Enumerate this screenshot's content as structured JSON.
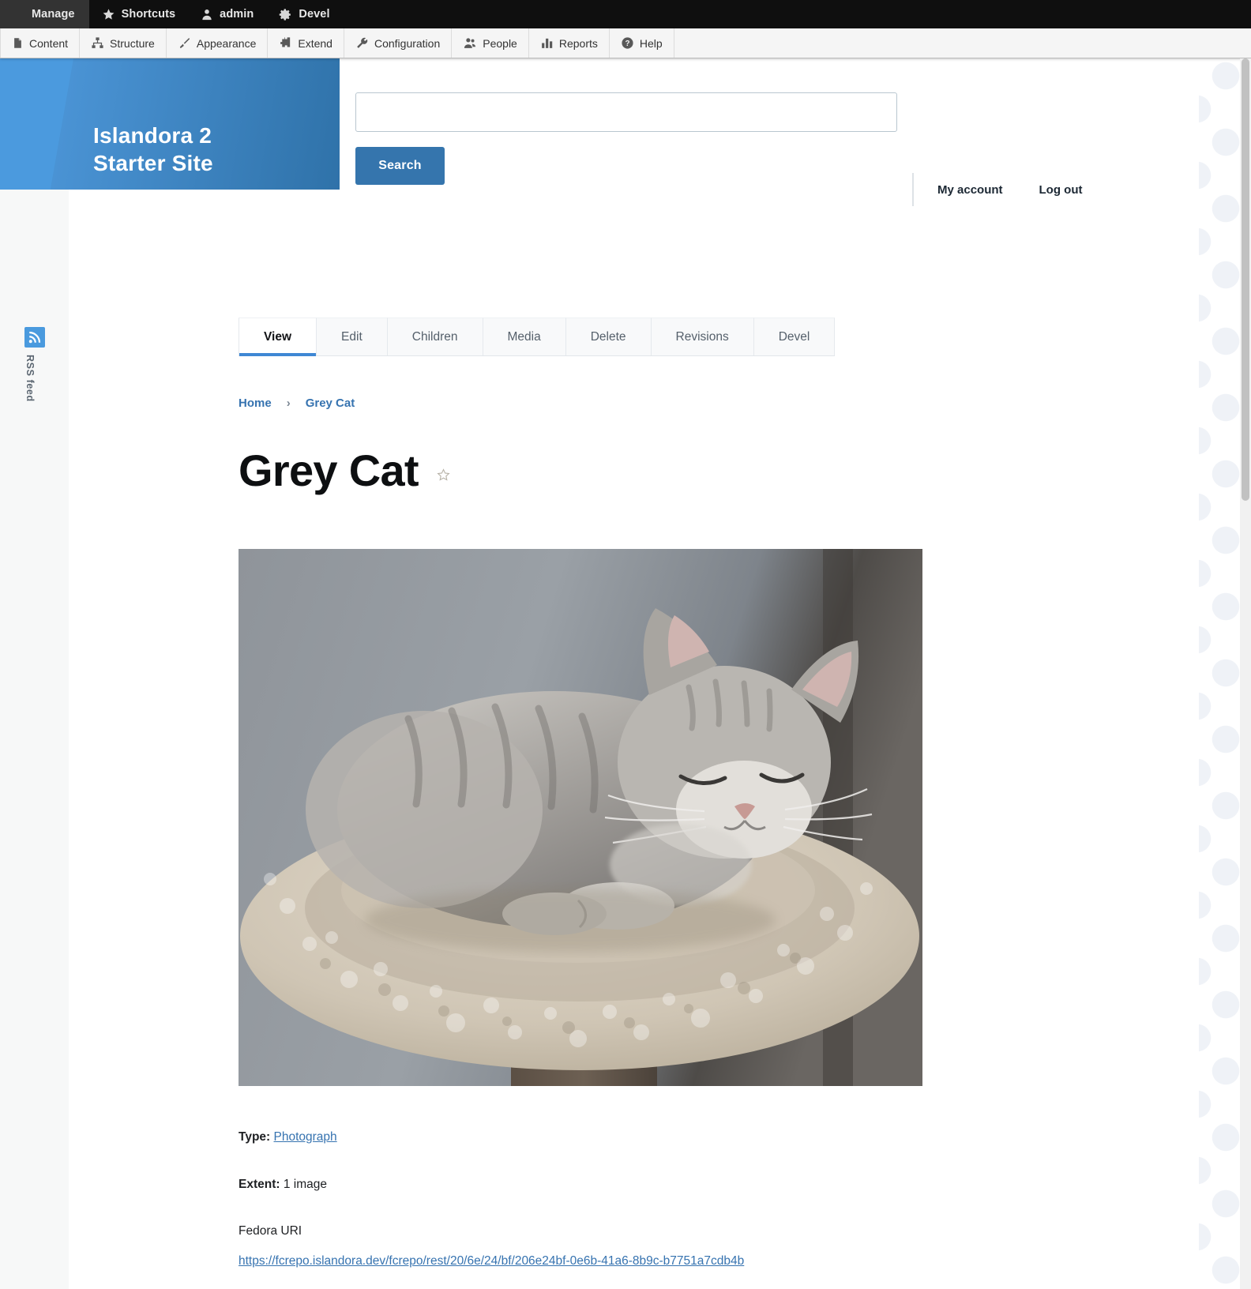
{
  "admin_toolbar": {
    "top_items": [
      {
        "label": "Manage",
        "icon": "hamburger-icon",
        "active": true
      },
      {
        "label": "Shortcuts",
        "icon": "star-icon",
        "active": false
      },
      {
        "label": "admin",
        "icon": "user-icon",
        "active": false
      },
      {
        "label": "Devel",
        "icon": "gear-icon",
        "active": false
      }
    ],
    "menu_items": [
      {
        "label": "Content",
        "icon": "file-icon"
      },
      {
        "label": "Structure",
        "icon": "sitemap-icon"
      },
      {
        "label": "Appearance",
        "icon": "brush-icon"
      },
      {
        "label": "Extend",
        "icon": "puzzle-icon"
      },
      {
        "label": "Configuration",
        "icon": "wrench-icon"
      },
      {
        "label": "People",
        "icon": "people-icon"
      },
      {
        "label": "Reports",
        "icon": "bar-chart-icon"
      },
      {
        "label": "Help",
        "icon": "question-circle-icon"
      }
    ]
  },
  "site_header": {
    "site_name_line1": "Islandora 2",
    "site_name_line2": "Starter Site",
    "banner_gradient_start": "#4b9ade",
    "banner_gradient_end": "#2f72a9"
  },
  "search": {
    "value": "",
    "placeholder": "",
    "button_label": "Search"
  },
  "account": {
    "my_account_label": "My account",
    "log_out_label": "Log out"
  },
  "rss": {
    "label": "RSS feed",
    "icon": "rss-icon",
    "accent": "#4a9ade"
  },
  "tabs": {
    "items": [
      {
        "label": "View",
        "active": true
      },
      {
        "label": "Edit",
        "active": false
      },
      {
        "label": "Children",
        "active": false
      },
      {
        "label": "Media",
        "active": false
      },
      {
        "label": "Delete",
        "active": false
      },
      {
        "label": "Revisions",
        "active": false
      },
      {
        "label": "Devel",
        "active": false
      }
    ],
    "active_underline_color": "#3f87d4"
  },
  "breadcrumb": {
    "home_label": "Home",
    "separator": "›",
    "current_label": "Grey Cat"
  },
  "node": {
    "title": "Grey Cat",
    "flag_icon": "star-outline-icon",
    "image_alt": "Grey Cat",
    "type_label": "Type:",
    "type_value": "Photograph",
    "extent_label": "Extent:",
    "extent_value": "1 image",
    "fedora_uri_label": "Fedora URI",
    "fedora_uri_value": "https://fcrepo.islandora.dev/fcrepo/rest/20/6e/24/bf/206e24bf-0e6b-41a6-8b9c-b7751a7cdb4b"
  },
  "colors": {
    "link": "#3673b0",
    "button_blue": "#3575ad",
    "toolbar_dark": "#0f0f0f",
    "toolbar_light": "#f5f5f5"
  }
}
